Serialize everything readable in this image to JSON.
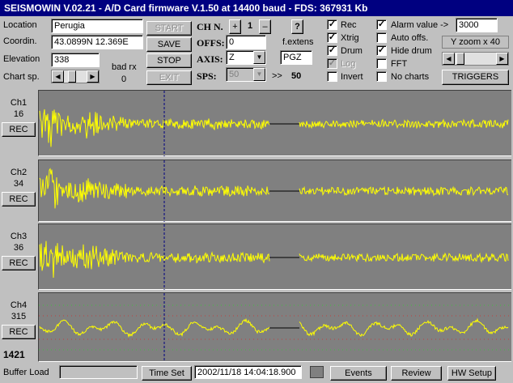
{
  "titlebar": {
    "text": "SEISMOWIN V.02.21  -  A/D Card firmware V.1.50 at 14400 baud   -  FDS: 367931 Kb"
  },
  "station": {
    "location_label": "Location",
    "location_value": "Perugia",
    "coord_label": "Coordin.",
    "coord_value": "43.0899N 12.369E",
    "elevation_label": "Elevation",
    "elevation_value": "338",
    "chart_speed_label": "Chart sp.",
    "bad_rx_label": "bad rx",
    "bad_rx_value": "0"
  },
  "buttons": {
    "start": "START",
    "save": "SAVE",
    "stop": "STOP",
    "exit": "EXIT"
  },
  "channel_ctrl": {
    "ch_label": "CH N.",
    "plus": "+",
    "ch_value": "1",
    "minus": "–",
    "help": "?",
    "offs_label": "OFFS:",
    "offs_value": "0",
    "axis_label": "AXIS:",
    "axis_value": "Z",
    "sps_label": "SPS:",
    "sps_value": "50",
    "sps_arrow": ">>",
    "sps_display": "50",
    "fextens_label": "f.extens",
    "fextens_value": "PGZ"
  },
  "checkboxes": {
    "rec": {
      "label": "Rec",
      "checked": true
    },
    "xtrig": {
      "label": "Xtrig",
      "checked": true
    },
    "drum": {
      "label": "Drum",
      "checked": true
    },
    "log": {
      "label": "Log",
      "checked": true,
      "disabled": true
    },
    "invert": {
      "label": "Invert",
      "checked": false
    },
    "alarm": {
      "label": "Alarm  value ->",
      "checked": true
    },
    "auto_offs": {
      "label": "Auto offs.",
      "checked": false
    },
    "hide_drum": {
      "label": "Hide drum",
      "checked": true
    },
    "fft": {
      "label": "FFT",
      "checked": false
    },
    "no_charts": {
      "label": "No charts",
      "checked": false
    }
  },
  "alarm_value": "3000",
  "zoom_label": "Y zoom x 40",
  "triggers_label": "TRIGGERS",
  "channels": [
    {
      "name": "Ch1",
      "value": "16",
      "rec": "REC"
    },
    {
      "name": "Ch2",
      "value": "34",
      "rec": "REC"
    },
    {
      "name": "Ch3",
      "value": "36",
      "rec": "REC"
    },
    {
      "name": "Ch4",
      "value": "315",
      "rec": "REC"
    }
  ],
  "counter": "1421",
  "status": {
    "buffer_label": "Buffer Load",
    "time_set": "Time Set",
    "datetime": "2002/11/18 14:04:18.900",
    "events": "Events",
    "review": "Review",
    "hw_setup": "HW Setup"
  },
  "colors": {
    "title_bg": "#000080",
    "trace": "#ffff00",
    "plot_bg": "#808080",
    "cursor": "#000080"
  }
}
